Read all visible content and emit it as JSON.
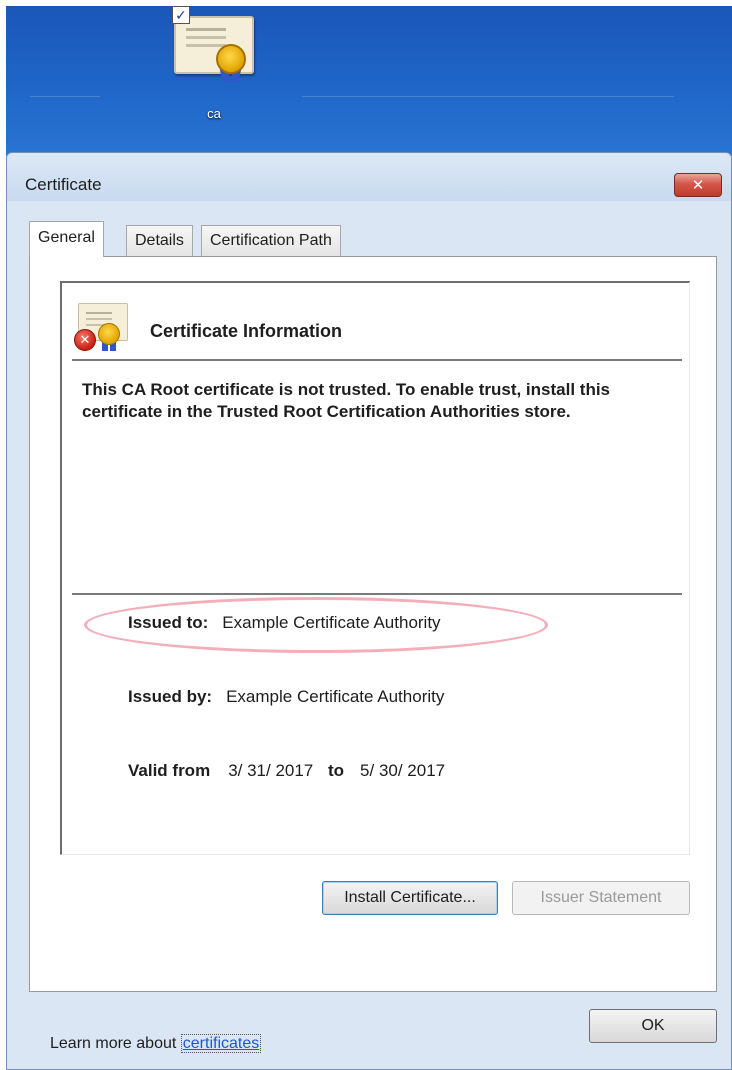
{
  "desktop": {
    "icon_label": "ca"
  },
  "window": {
    "title": "Certificate",
    "close_label": "✕"
  },
  "tabs": [
    {
      "label": "General"
    },
    {
      "label": "Details"
    },
    {
      "label": "Certification Path"
    }
  ],
  "general": {
    "info_title": "Certificate Information",
    "warning": "This CA Root certificate is not trusted. To enable trust, install this certificate in the Trusted Root Certification Authorities store.",
    "issued_to_label": "Issued to:",
    "issued_to_value": "Example Certificate Authority",
    "issued_by_label": "Issued by:",
    "issued_by_value": "Example Certificate Authority",
    "valid_from_label": "Valid from",
    "valid_from_value": "3/ 31/ 2017",
    "valid_to_label": "to",
    "valid_to_value": "5/ 30/ 2017",
    "install_button": "Install Certificate...",
    "issuer_statement_button": "Issuer Statement",
    "learn_more_prefix": "Learn more about",
    "learn_more_link": "certificates"
  },
  "footer": {
    "ok_button": "OK"
  },
  "icons": {
    "desktop": "certificate-file-icon",
    "info": "certificate-error-icon",
    "close": "close-icon"
  },
  "colors": {
    "desktop_blue": "#1f66c8",
    "window_frame": "#dbe6f4",
    "close_red": "#c23a2c",
    "link_blue": "#1f56d6",
    "highlight_pink": "#f3a5b2"
  }
}
